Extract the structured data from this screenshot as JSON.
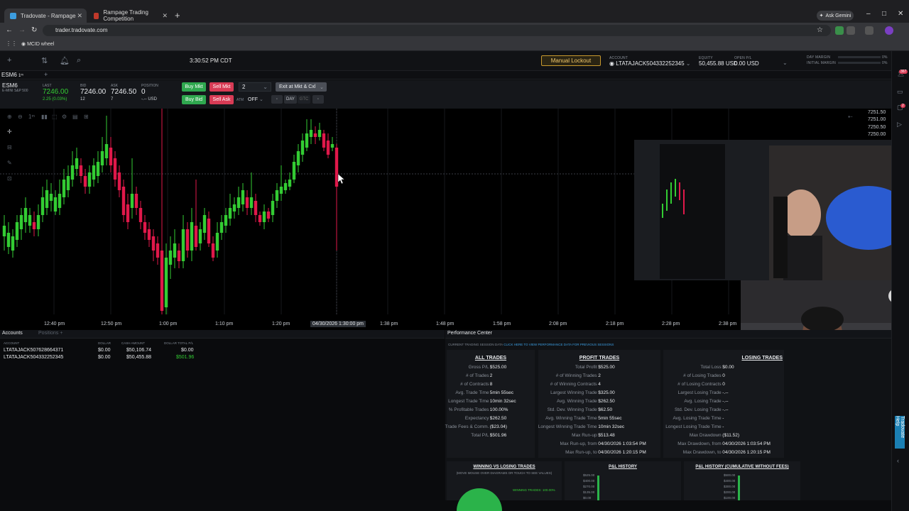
{
  "browser": {
    "tabs": [
      {
        "title": "Tradovate - Rampage",
        "active": true
      },
      {
        "title": "Rampage Trading Competition",
        "active": false
      }
    ],
    "url": "trader.tradovate.com",
    "bookmark": "MCID wheel",
    "gemini": "Ask Gemini"
  },
  "app": {
    "clock": "3:30:52 PM CDT",
    "lockout_label": "Manual Lockout",
    "account_label": "ACCOUNT",
    "account_value": "LTATAJACK504332252345",
    "equity_label": "EQUITY",
    "equity_value": "50,455.88 USD",
    "open_pl_label": "OPEN P/L",
    "open_pl_value": "0.00 USD",
    "day_margin_label": "DAY MARGIN",
    "day_margin_value": "0%",
    "initial_margin_label": "INITIAL MARGIN",
    "initial_margin_value": "0%"
  },
  "quote": {
    "symbol_tab": "ESM6",
    "symbol": "ESM6",
    "symbol_desc": "E-MINI S&P 500",
    "last_label": "LAST",
    "last": "7246.00",
    "change": "2.25 (0.03%)",
    "bid_label": "BID",
    "bid": "7246.00",
    "bid_size": "12",
    "ask_label": "ASK",
    "ask": "7246.50",
    "ask_size": "7",
    "position_label": "POSITION",
    "position": "0",
    "position_sub": "-.-- USD",
    "buy_mkt": "Buy Mkt",
    "sell_mkt": "Sell Mkt",
    "qty": "2",
    "exit": "Exit at Mkt & Cxl",
    "buy_bid": "Buy Bid",
    "sell_ask": "Sell Ask",
    "atm_label": "ATM",
    "atm_value": "OFF",
    "tif_day": "DAY",
    "tif_gtc": "GTC"
  },
  "chart": {
    "price_labels": [
      "7251.50",
      "7251.00",
      "7250.50",
      "7250.00"
    ],
    "time_labels": [
      "12:40 pm",
      "12:50 pm",
      "1:00 pm",
      "1:10 pm",
      "1:20 pm",
      "1:38 pm",
      "1:48 pm",
      "1:58 pm",
      "2:08 pm",
      "2:18 pm",
      "2:28 pm",
      "2:38 pm"
    ],
    "crosshair_time": "04/30/2026 1:30:00 pm",
    "up_color": "#33cc33",
    "down_color": "#e0184a"
  },
  "accounts": {
    "tab_accounts": "Accounts",
    "tab_positions": "Positions",
    "headers": [
      "ACCOUNT",
      "DOLLAR",
      "CASH AMOUNT",
      "DOLLAR TOTAL P/L"
    ],
    "rows": [
      {
        "account": "LTATAJACK507628664371",
        "dollar": "$0.00",
        "cash": "$50,106.74",
        "pl": "$0.00"
      },
      {
        "account": "LTATAJACK504332252345",
        "dollar": "$0.00",
        "cash": "$50,455.88",
        "pl": "$501.96"
      }
    ]
  },
  "perf": {
    "title": "Performance Center",
    "note_prefix": "CURRENT TRADING SESSION DATA",
    "note_link": "CLICK HERE TO VIEW PERFORMANCE DATA FOR PREVIOUS SESSIONS",
    "all_title": "ALL TRADES",
    "all_rows": [
      {
        "k": "Gross P/L",
        "v": "$525.00"
      },
      {
        "k": "# of Trades",
        "v": "2"
      },
      {
        "k": "# of Contracts",
        "v": "8"
      },
      {
        "k": "Avg. Trade Time",
        "v": "5min 55sec"
      },
      {
        "k": "Longest Trade Time",
        "v": "10min 32sec"
      },
      {
        "k": "% Profitable Trades",
        "v": "100.00%"
      },
      {
        "k": "Expectancy",
        "v": "$262.50"
      },
      {
        "k": "Trade Fees & Comm.",
        "v": "($23.04)"
      },
      {
        "k": "Total P/L",
        "v": "$501.96"
      }
    ],
    "profit_title": "PROFIT TRADES",
    "profit_rows": [
      {
        "k": "Total Profit",
        "v": "$525.00"
      },
      {
        "k": "# of Winning Trades",
        "v": "2"
      },
      {
        "k": "# of Winning Contracts",
        "v": "4"
      },
      {
        "k": "Largest Winning Trade",
        "v": "$325.00"
      },
      {
        "k": "Avg. Winning Trade",
        "v": "$262.50"
      },
      {
        "k": "Std. Dev. Winning Trade",
        "v": "$62.50"
      },
      {
        "k": "Avg. Winning Trade Time",
        "v": "5min 55sec"
      },
      {
        "k": "Longest Winning Trade Time",
        "v": "10min 32sec"
      },
      {
        "k": "Max Run-up",
        "v": "$513.48"
      },
      {
        "k": "Max Run-up, from",
        "v": "04/30/2026 1:03:54 PM"
      },
      {
        "k": "Max Run-up, to",
        "v": "04/30/2026 1:20:15 PM"
      }
    ],
    "losing_title": "LOSING TRADES",
    "losing_rows": [
      {
        "k": "Total Loss",
        "v": "$0.00"
      },
      {
        "k": "# of Losing Trades",
        "v": "0"
      },
      {
        "k": "# of Losing Contracts",
        "v": "0"
      },
      {
        "k": "Largest Losing Trade",
        "v": "-.--"
      },
      {
        "k": "Avg. Losing Trade",
        "v": "-.--"
      },
      {
        "k": "Std. Dev. Losing Trade",
        "v": "-.--"
      },
      {
        "k": "Avg. Losing Trade Time",
        "v": "-"
      },
      {
        "k": "Longest Losing Trade Time",
        "v": "-"
      },
      {
        "k": "Max Drawdown",
        "v": "($11.52)"
      },
      {
        "k": "Max Drawdown, from",
        "v": "04/30/2026 1:03:54 PM"
      },
      {
        "k": "Max Drawdown, to",
        "v": "04/30/2026 1:20:15 PM"
      }
    ],
    "box1_title": "WINNING VS LOSING TRADES",
    "box1_sub": "(MOVE MOUSE OVER DIAGRAMS OR TOUCH TO SEE VALUES)",
    "box1_legend": "WINNING TRADES: 100.00%",
    "box2_title": "P&L HISTORY",
    "box3_title": "P&L HISTORY (CUMULATIVE WITHOUT FEES)",
    "box2_ticks": [
      "$525.00",
      "$400.00",
      "$270.00",
      "$135.00",
      "$0.00"
    ],
    "box3_ticks": [
      "$500.00",
      "$400.00",
      "$300.00",
      "$200.00",
      "$100.00"
    ]
  },
  "rail": {
    "help": "Tradovate Help",
    "badge1": "367",
    "badge2": "2"
  }
}
